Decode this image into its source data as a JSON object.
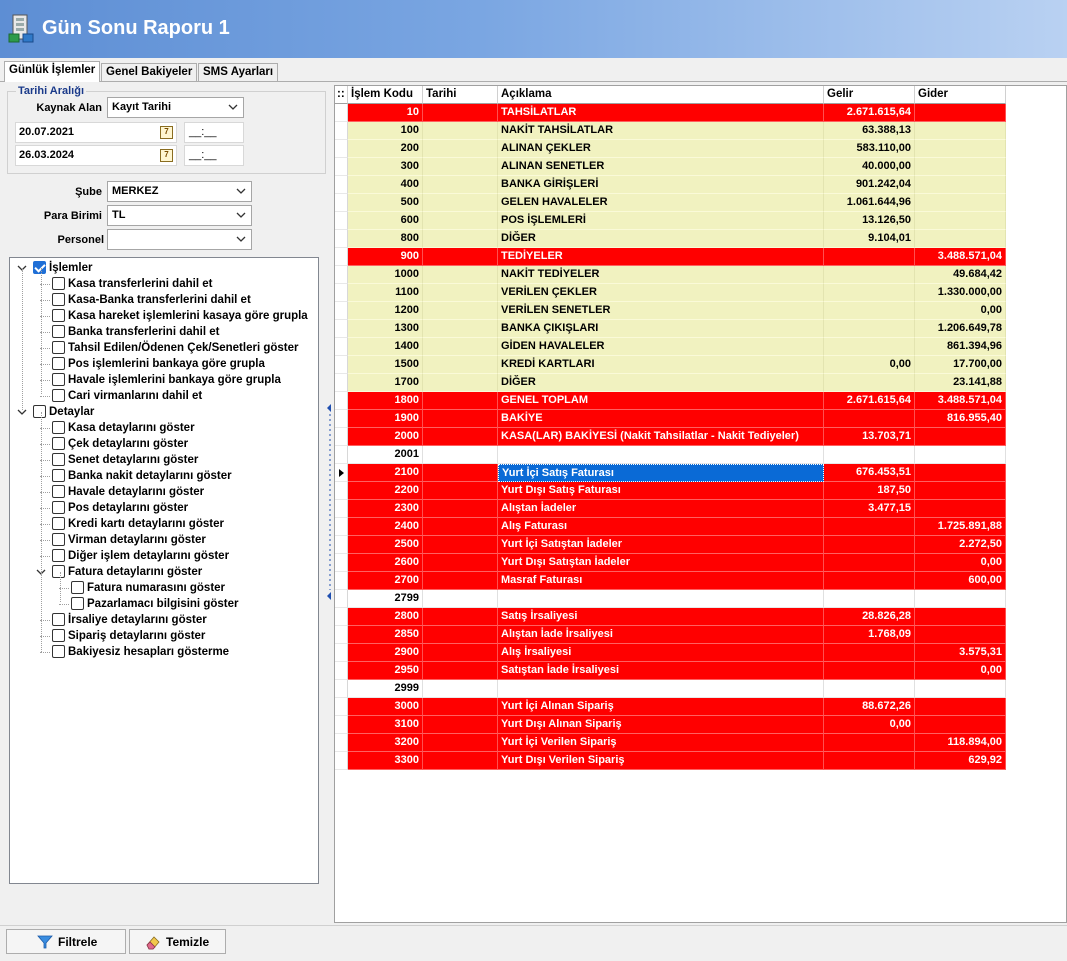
{
  "window": {
    "title": "Gün Sonu Raporu 1"
  },
  "tabs": [
    "Günlük İşlemler",
    "Genel Bakiyeler",
    "SMS Ayarları"
  ],
  "filters": {
    "date_group_title": "Tarihi Aralığı",
    "kaynak_alan_label": "Kaynak Alan",
    "kaynak_alan_value": "Kayıt Tarihi",
    "start_date": "20.07.2021",
    "end_date": "26.03.2024",
    "time_placeholder": "__:__",
    "sube_label": "Şube",
    "sube_value": "MERKEZ",
    "para_birimi_label": "Para Birimi",
    "para_birimi_value": "TL",
    "personel_label": "Personel",
    "personel_value": ""
  },
  "tree": [
    {
      "label": "İşlemler",
      "checked": true,
      "level": 0,
      "expanded": true
    },
    {
      "label": "Kasa transferlerini dahil et",
      "checked": false,
      "level": 1
    },
    {
      "label": "Kasa-Banka transferlerini dahil et",
      "checked": false,
      "level": 1
    },
    {
      "label": "Kasa hareket işlemlerini kasaya göre grupla",
      "checked": false,
      "level": 1
    },
    {
      "label": "Banka transferlerini dahil et",
      "checked": false,
      "level": 1
    },
    {
      "label": "Tahsil Edilen/Ödenen Çek/Senetleri göster",
      "checked": false,
      "level": 1
    },
    {
      "label": "Pos işlemlerini bankaya göre grupla",
      "checked": false,
      "level": 1
    },
    {
      "label": "Havale işlemlerini bankaya göre grupla",
      "checked": false,
      "level": 1
    },
    {
      "label": "Cari virmanlarını dahil et",
      "checked": false,
      "level": 1
    },
    {
      "label": "Detaylar",
      "checked": false,
      "level": 0,
      "expanded": true
    },
    {
      "label": "Kasa detaylarını göster",
      "checked": false,
      "level": 1
    },
    {
      "label": "Çek detaylarını göster",
      "checked": false,
      "level": 1
    },
    {
      "label": "Senet detaylarını göster",
      "checked": false,
      "level": 1
    },
    {
      "label": "Banka nakit detaylarını göster",
      "checked": false,
      "level": 1
    },
    {
      "label": "Havale detaylarını göster",
      "checked": false,
      "level": 1
    },
    {
      "label": "Pos detaylarını göster",
      "checked": false,
      "level": 1
    },
    {
      "label": "Kredi kartı detaylarını göster",
      "checked": false,
      "level": 1
    },
    {
      "label": "Virman detaylarını göster",
      "checked": false,
      "level": 1
    },
    {
      "label": "Diğer işlem detaylarını göster",
      "checked": false,
      "level": 1
    },
    {
      "label": "Fatura detaylarını göster",
      "checked": false,
      "level": 1,
      "expanded": true
    },
    {
      "label": "Fatura numarasını göster",
      "checked": false,
      "level": 2
    },
    {
      "label": "Pazarlamacı bilgisini göster",
      "checked": false,
      "level": 2
    },
    {
      "label": "İrsaliye detaylarını göster",
      "checked": false,
      "level": 1
    },
    {
      "label": "Sipariş detaylarını göster",
      "checked": false,
      "level": 1
    },
    {
      "label": "Bakiyesiz hesapları gösterme",
      "checked": false,
      "level": 1
    }
  ],
  "grid": {
    "header_marker": "::",
    "columns": [
      "İşlem Kodu",
      "Tarihi",
      "Açıklama",
      "Gelir",
      "Gider"
    ],
    "rows": [
      {
        "kod": "10",
        "aciklama": "TAHSİLATLAR",
        "gelir": "2.671.615,64",
        "gider": "",
        "style": "red"
      },
      {
        "kod": "100",
        "aciklama": "NAKİT TAHSİLATLAR",
        "gelir": "63.388,13",
        "gider": "",
        "style": "yellow"
      },
      {
        "kod": "200",
        "aciklama": "ALINAN ÇEKLER",
        "gelir": "583.110,00",
        "gider": "",
        "style": "yellow"
      },
      {
        "kod": "300",
        "aciklama": "ALINAN SENETLER",
        "gelir": "40.000,00",
        "gider": "",
        "style": "yellow"
      },
      {
        "kod": "400",
        "aciklama": "BANKA GİRİŞLERİ",
        "gelir": "901.242,04",
        "gider": "",
        "style": "yellow"
      },
      {
        "kod": "500",
        "aciklama": "GELEN HAVALELER",
        "gelir": "1.061.644,96",
        "gider": "",
        "style": "yellow"
      },
      {
        "kod": "600",
        "aciklama": "POS İŞLEMLERİ",
        "gelir": "13.126,50",
        "gider": "",
        "style": "yellow"
      },
      {
        "kod": "800",
        "aciklama": "DİĞER",
        "gelir": "9.104,01",
        "gider": "",
        "style": "yellow"
      },
      {
        "kod": "900",
        "aciklama": "TEDİYELER",
        "gelir": "",
        "gider": "3.488.571,04",
        "style": "red"
      },
      {
        "kod": "1000",
        "aciklama": "NAKİT TEDİYELER",
        "gelir": "",
        "gider": "49.684,42",
        "style": "yellow"
      },
      {
        "kod": "1100",
        "aciklama": "VERİLEN ÇEKLER",
        "gelir": "",
        "gider": "1.330.000,00",
        "style": "yellow"
      },
      {
        "kod": "1200",
        "aciklama": "VERİLEN SENETLER",
        "gelir": "",
        "gider": "0,00",
        "style": "yellow"
      },
      {
        "kod": "1300",
        "aciklama": "BANKA ÇIKIŞLARI",
        "gelir": "",
        "gider": "1.206.649,78",
        "style": "yellow"
      },
      {
        "kod": "1400",
        "aciklama": "GİDEN HAVALELER",
        "gelir": "",
        "gider": "861.394,96",
        "style": "yellow"
      },
      {
        "kod": "1500",
        "aciklama": "KREDİ KARTLARI",
        "gelir": "0,00",
        "gider": "17.700,00",
        "style": "yellow"
      },
      {
        "kod": "1700",
        "aciklama": "DİĞER",
        "gelir": "",
        "gider": "23.141,88",
        "style": "yellow"
      },
      {
        "kod": "1800",
        "aciklama": "GENEL TOPLAM",
        "gelir": "2.671.615,64",
        "gider": "3.488.571,04",
        "style": "red"
      },
      {
        "kod": "1900",
        "aciklama": "BAKİYE",
        "gelir": "",
        "gider": "816.955,40",
        "style": "red"
      },
      {
        "kod": "2000",
        "aciklama": "KASA(LAR) BAKİYESİ (Nakit Tahsilatlar - Nakit Tediyeler)",
        "gelir": "13.703,71",
        "gider": "",
        "style": "red"
      },
      {
        "kod": "2001",
        "aciklama": "",
        "gelir": "",
        "gider": "",
        "style": "white"
      },
      {
        "kod": "2100",
        "aciklama": "Yurt İçi Satış Faturası",
        "gelir": "676.453,51",
        "gider": "",
        "style": "red",
        "selected": true
      },
      {
        "kod": "2200",
        "aciklama": "Yurt Dışı Satış Faturası",
        "gelir": "187,50",
        "gider": "",
        "style": "red"
      },
      {
        "kod": "2300",
        "aciklama": "Alıştan İadeler",
        "gelir": "3.477,15",
        "gider": "",
        "style": "red"
      },
      {
        "kod": "2400",
        "aciklama": "Alış Faturası",
        "gelir": "",
        "gider": "1.725.891,88",
        "style": "red"
      },
      {
        "kod": "2500",
        "aciklama": "Yurt İçi Satıştan İadeler",
        "gelir": "",
        "gider": "2.272,50",
        "style": "red"
      },
      {
        "kod": "2600",
        "aciklama": "Yurt Dışı Satıştan İadeler",
        "gelir": "",
        "gider": "0,00",
        "style": "red"
      },
      {
        "kod": "2700",
        "aciklama": "Masraf Faturası",
        "gelir": "",
        "gider": "600,00",
        "style": "red"
      },
      {
        "kod": "2799",
        "aciklama": "",
        "gelir": "",
        "gider": "",
        "style": "white"
      },
      {
        "kod": "2800",
        "aciklama": "Satış İrsaliyesi",
        "gelir": "28.826,28",
        "gider": "",
        "style": "red"
      },
      {
        "kod": "2850",
        "aciklama": "Alıştan İade İrsaliyesi",
        "gelir": "1.768,09",
        "gider": "",
        "style": "red"
      },
      {
        "kod": "2900",
        "aciklama": "Alış İrsaliyesi",
        "gelir": "",
        "gider": "3.575,31",
        "style": "red"
      },
      {
        "kod": "2950",
        "aciklama": "Satıştan İade İrsaliyesi",
        "gelir": "",
        "gider": "0,00",
        "style": "red"
      },
      {
        "kod": "2999",
        "aciklama": "",
        "gelir": "",
        "gider": "",
        "style": "white"
      },
      {
        "kod": "3000",
        "aciklama": "Yurt İçi Alınan Sipariş",
        "gelir": "88.672,26",
        "gider": "",
        "style": "red"
      },
      {
        "kod": "3100",
        "aciklama": "Yurt Dışı Alınan Sipariş",
        "gelir": "0,00",
        "gider": "",
        "style": "red"
      },
      {
        "kod": "3200",
        "aciklama": "Yurt İçi Verilen Sipariş",
        "gelir": "",
        "gider": "118.894,00",
        "style": "red"
      },
      {
        "kod": "3300",
        "aciklama": "Yurt Dışı Verilen Sipariş",
        "gelir": "",
        "gider": "629,92",
        "style": "red"
      }
    ]
  },
  "buttons": {
    "filtrele": "Filtrele",
    "temizle": "Temizle"
  },
  "colors": {
    "red": "#ff0000",
    "yellow": "#f1f2c0",
    "selected": "#0a6ad6",
    "title_bar": "#6d9ad9"
  },
  "icons": [
    "app-icon",
    "calendar-icon",
    "chevron-down-icon",
    "filter-icon",
    "eraser-icon",
    "row-pointer-icon"
  ]
}
